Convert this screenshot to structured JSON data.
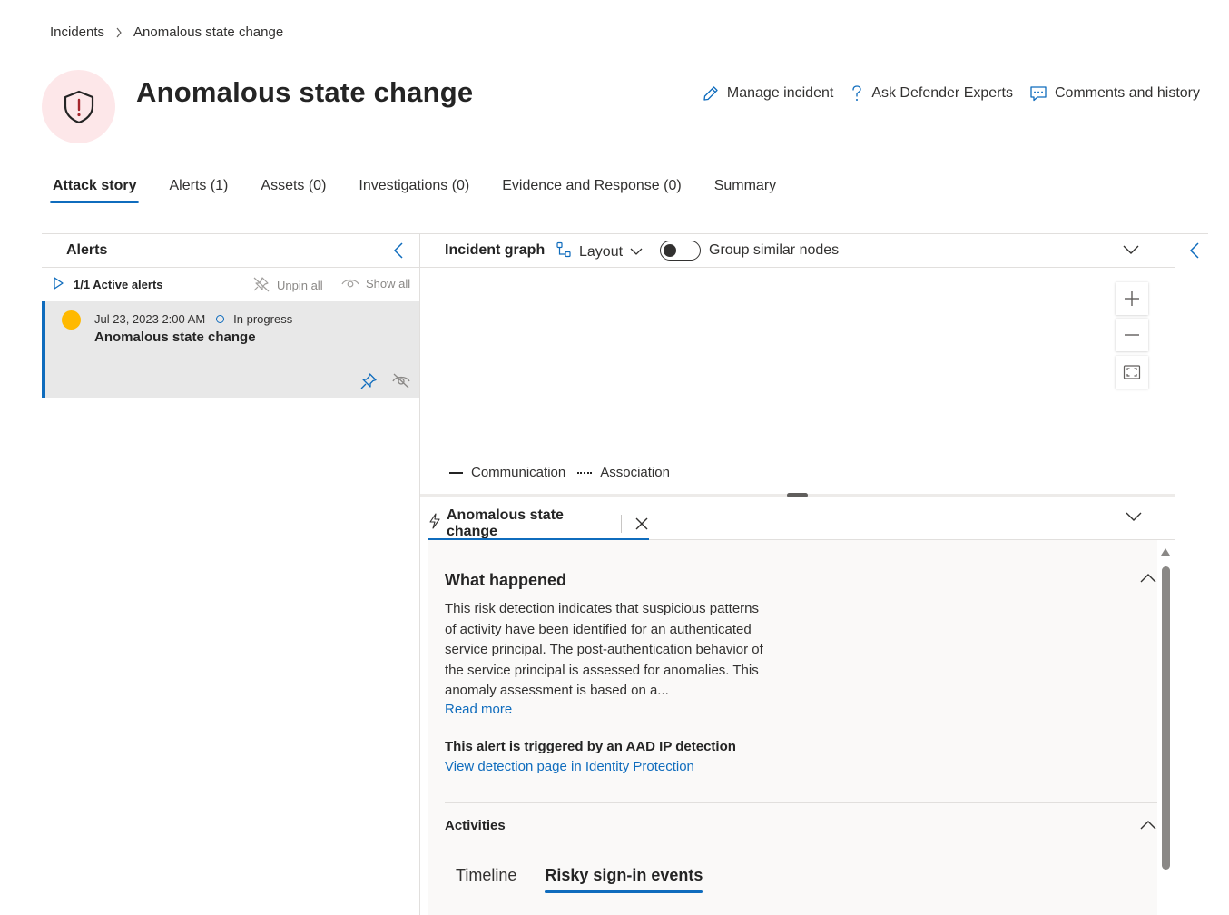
{
  "breadcrumb": {
    "root": "Incidents",
    "current": "Anomalous state change"
  },
  "header": {
    "title": "Anomalous state change",
    "icon": "shield-alert-icon",
    "actions": {
      "manage": "Manage incident",
      "ask": "Ask Defender Experts",
      "comments": "Comments and history"
    }
  },
  "tabs": [
    "Attack story",
    "Alerts (1)",
    "Assets (0)",
    "Investigations (0)",
    "Evidence and Response (0)",
    "Summary"
  ],
  "alerts_panel": {
    "title": "Alerts",
    "active_alerts": "1/1 Active alerts",
    "unpin_all": "Unpin all",
    "show_all": "Show all",
    "card": {
      "date": "Jul 23, 2023 2:00 AM",
      "status": "In progress",
      "name": "Anomalous state change",
      "severity_color": "#ffb900"
    }
  },
  "graph": {
    "title": "Incident graph",
    "layout": "Layout",
    "toggle_label": "Group similar nodes",
    "legend": {
      "communication": "Communication",
      "association": "Association"
    }
  },
  "detail": {
    "tab_label": "Anomalous state change",
    "what_happened": {
      "title": "What happened",
      "lines": [
        "This risk detection indicates that suspicious patterns",
        "of activity have been identified for an authenticated",
        "service principal. The post-authentication behavior of",
        "the service principal is assessed for anomalies. This",
        "anomaly assessment is based on a..."
      ],
      "read_more": "Read more",
      "trigger_text": "This alert is triggered by an AAD IP detection",
      "trigger_link": "View detection page in Identity Protection"
    },
    "activities": {
      "title": "Activities",
      "tabs": [
        "Timeline",
        "Risky sign-in events"
      ]
    }
  },
  "colors": {
    "accent": "#0f6cbd",
    "severity": "#ffb900",
    "icon_bg": "#fde7e9"
  }
}
